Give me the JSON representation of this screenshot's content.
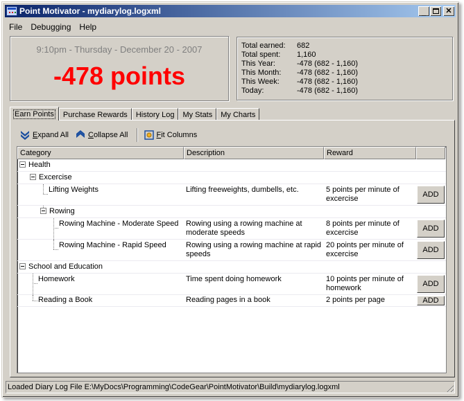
{
  "window": {
    "title": "Point Motivator - mydiarylog.logxml",
    "controls": {
      "minimize": "_",
      "maximize": "□",
      "close": "×"
    }
  },
  "menu": [
    "File",
    "Debugging",
    "Help"
  ],
  "clock": {
    "datetime": "9:10pm - Thursday - December 20 - 2007",
    "points": "-478 points",
    "points_color": "#ff0000"
  },
  "stats": [
    {
      "label": "Total earned:",
      "value": "682"
    },
    {
      "label": "Total spent:",
      "value": "1,160"
    },
    {
      "label": "This Year:",
      "value": "-478 (682 - 1,160)"
    },
    {
      "label": "This Month:",
      "value": "-478 (682 - 1,160)"
    },
    {
      "label": "This Week:",
      "value": "-478 (682 - 1,160)"
    },
    {
      "label": "Today:",
      "value": "-478 (682 - 1,160)"
    }
  ],
  "tabs": [
    {
      "label": "Earn Points",
      "active": true
    },
    {
      "label": "Purchase Rewards",
      "active": false
    },
    {
      "label": "History Log",
      "active": false
    },
    {
      "label": "My Stats",
      "active": false
    },
    {
      "label": "My Charts",
      "active": false
    }
  ],
  "toolbar": {
    "expand_all": {
      "accel": "E",
      "rest": "xpand All"
    },
    "collapse_all": {
      "accel": "C",
      "rest": "ollapse All"
    },
    "fit_columns": {
      "accel": "F",
      "rest": "it Columns"
    }
  },
  "grid": {
    "columns": [
      "Category",
      "Description",
      "Reward",
      ""
    ],
    "add_label": "ADD",
    "rows": [
      {
        "type": "group",
        "level": 0,
        "name": "Health"
      },
      {
        "type": "group",
        "level": 1,
        "name": "Excercise"
      },
      {
        "type": "item",
        "level": 2,
        "name": "Lifting Weights",
        "description": "Lifting freeweights, dumbells, etc.",
        "reward": "5 points per minute of excercise"
      },
      {
        "type": "group",
        "level": 2,
        "name": "Rowing"
      },
      {
        "type": "item",
        "level": 3,
        "name": "Rowing Machine - Moderate Speed",
        "description": "Rowing using a rowing machine at moderate speeds",
        "reward": "8 points per minute of excercise"
      },
      {
        "type": "item",
        "level": 3,
        "name": "Rowing Machine - Rapid Speed",
        "description": "Rowing using a rowing machine at rapid speeds",
        "reward": "20 points per minute of excercise"
      },
      {
        "type": "group",
        "level": 0,
        "name": "School and Education"
      },
      {
        "type": "item",
        "level": 1,
        "name": "Homework",
        "description": "Time spent doing homework",
        "reward": "10 points per minute of homework"
      },
      {
        "type": "item",
        "level": 1,
        "name": "Reading a Book",
        "description": "Reading pages in a book",
        "reward": "2 points per page"
      }
    ]
  },
  "status": "Loaded Diary Log File E:\\MyDocs\\Programming\\CodeGear\\PointMotivator\\Build\\mydiarylog.logxml"
}
